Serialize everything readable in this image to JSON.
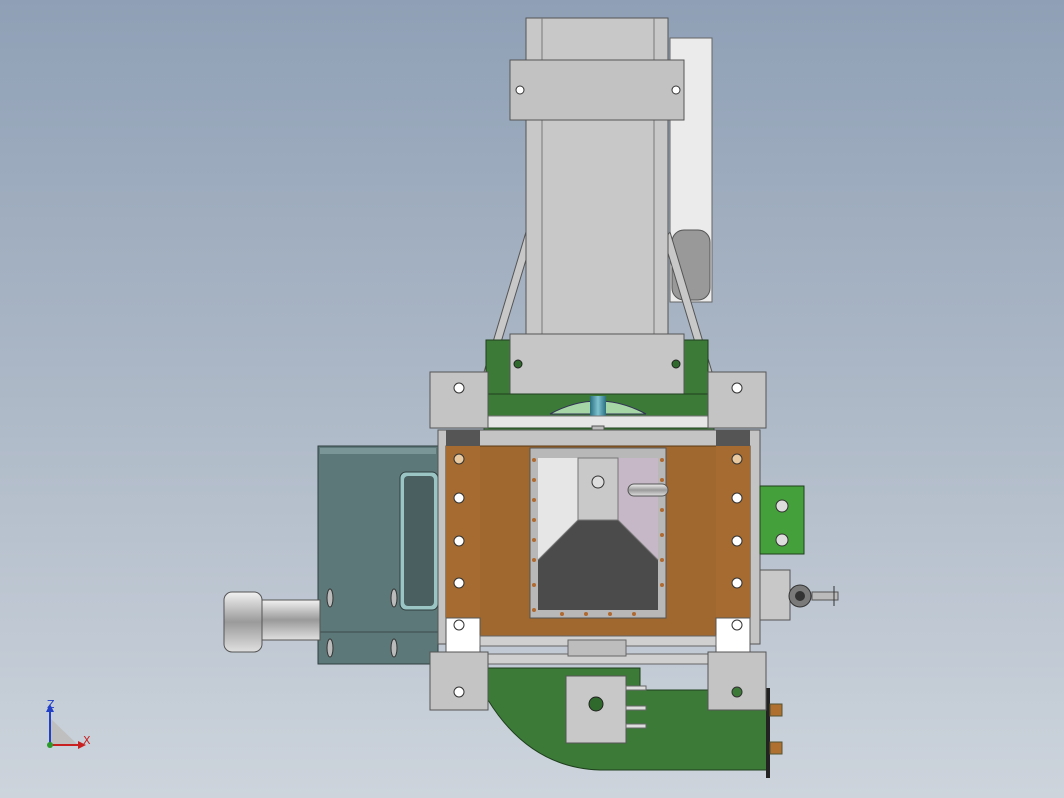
{
  "viewport": {
    "background_top": "#8fa0b6",
    "background_bottom": "#cdd4dc"
  },
  "model": {
    "frame_color": "#c4c4c4",
    "plate_color": "#a0672e",
    "green_color": "#3f7a3a",
    "motor_color": "#5d7878",
    "seal_color": "#e03a22"
  },
  "triad": {
    "z_label": "Z",
    "x_label": "X",
    "z_color": "#2340c8",
    "x_color": "#c82020"
  }
}
